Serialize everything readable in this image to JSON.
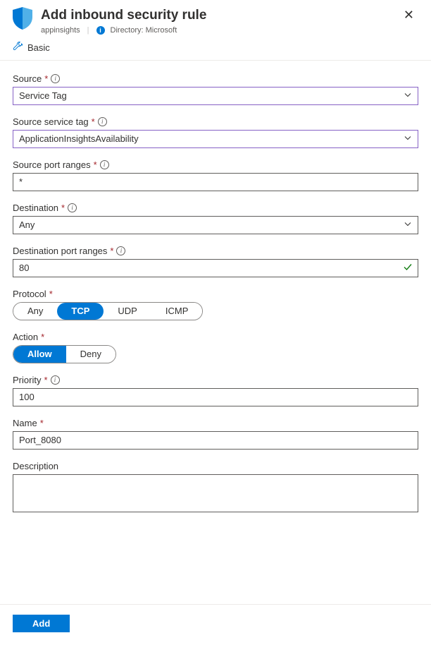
{
  "header": {
    "title": "Add inbound security rule",
    "resource_name": "appinsights",
    "directory_label": "Directory: Microsoft"
  },
  "toolbar": {
    "basic_label": "Basic"
  },
  "form": {
    "source": {
      "label": "Source",
      "value": "Service Tag"
    },
    "source_service_tag": {
      "label": "Source service tag",
      "value": "ApplicationInsightsAvailability"
    },
    "source_port_ranges": {
      "label": "Source port ranges",
      "value": "*"
    },
    "destination": {
      "label": "Destination",
      "value": "Any"
    },
    "destination_port_ranges": {
      "label": "Destination port ranges",
      "value": "80"
    },
    "protocol": {
      "label": "Protocol",
      "options": [
        "Any",
        "TCP",
        "UDP",
        "ICMP"
      ],
      "selected": "TCP"
    },
    "action": {
      "label": "Action",
      "options": [
        "Allow",
        "Deny"
      ],
      "selected": "Allow"
    },
    "priority": {
      "label": "Priority",
      "value": "100"
    },
    "name": {
      "label": "Name",
      "value": "Port_8080"
    },
    "description": {
      "label": "Description",
      "value": ""
    }
  },
  "footer": {
    "add_label": "Add"
  }
}
